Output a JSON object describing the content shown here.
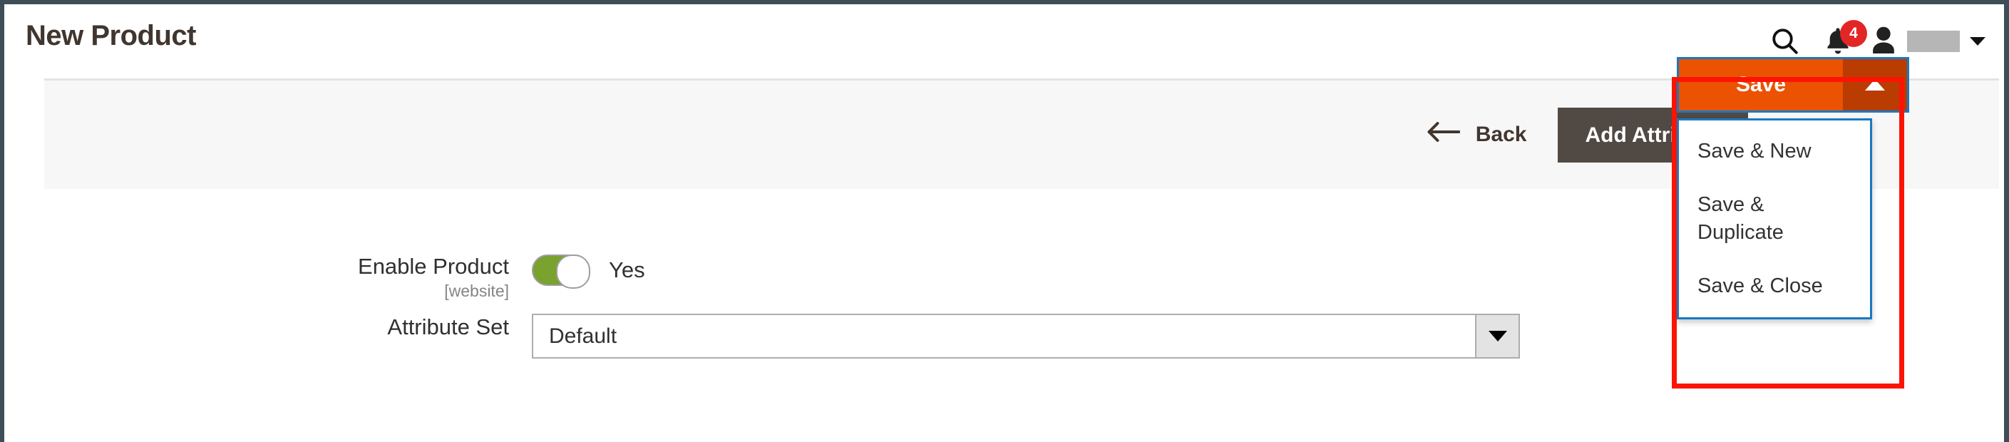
{
  "header": {
    "title": "New Product",
    "search_icon": "search-icon",
    "notifications_icon": "bell-icon",
    "notifications_count": "4",
    "user_icon": "person-icon",
    "user_caret_icon": "chevron-down-icon"
  },
  "toolbar": {
    "back_label": "Back",
    "back_icon": "arrow-left-icon",
    "add_attribute_label": "Add Attribute",
    "save_label": "Save",
    "save_toggle_icon": "chevron-up-icon",
    "save_menu": [
      {
        "label": "Save & New"
      },
      {
        "label": "Save & Duplicate"
      },
      {
        "label": "Save & Close"
      }
    ]
  },
  "form": {
    "enable_product": {
      "label": "Enable Product",
      "scope": "[website]",
      "value": "Yes",
      "state": "on"
    },
    "attribute_set": {
      "label": "Attribute Set",
      "value": "Default",
      "placeholder": "Default",
      "caret_icon": "chevron-down-icon"
    }
  },
  "colors": {
    "accent_orange": "#eb5202",
    "accent_orange_dark": "#ba3c02",
    "dark_brown": "#514943",
    "focus_blue": "#1979c3",
    "highlight_red": "#fb1404",
    "toggle_green": "#79a22e",
    "badge_red": "#e22626",
    "page_border": "#3d4e57"
  }
}
